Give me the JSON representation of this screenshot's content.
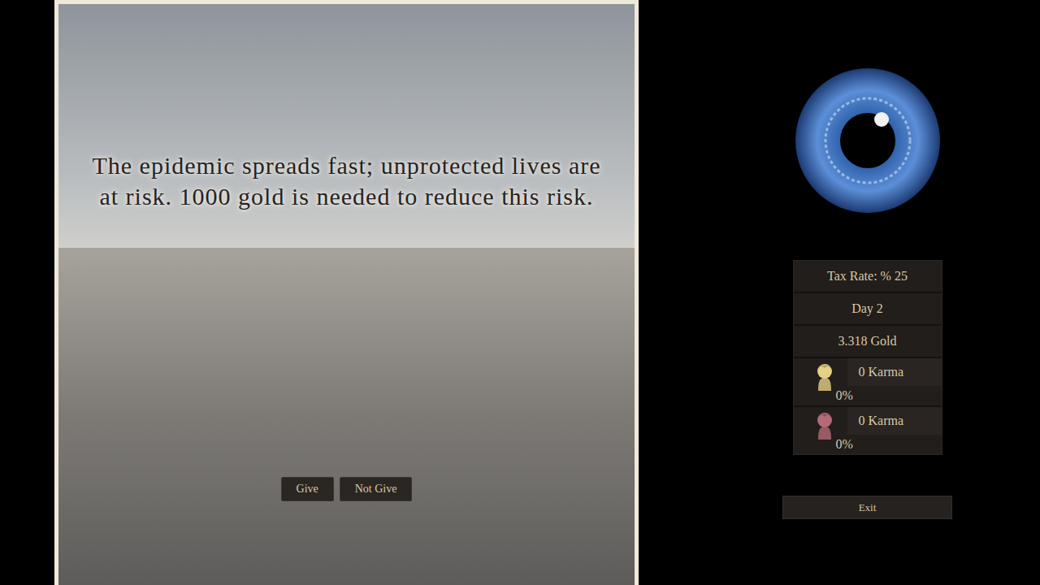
{
  "scene": {
    "caption": "The epidemic spreads fast; unprotected lives are at risk. 1000 gold is needed to reduce this risk.",
    "choices": [
      {
        "label": "Give"
      },
      {
        "label": "Not Give"
      }
    ]
  },
  "stats": {
    "tax_rate": "Tax Rate: % 25",
    "day": "Day 2",
    "gold": "3.318 Gold",
    "factions": [
      {
        "karma": "0 Karma",
        "share": "0%",
        "color": "#e6cf86"
      },
      {
        "karma": "0 Karma",
        "share": "0%",
        "color": "#b46a78"
      }
    ]
  },
  "exit": "Exit"
}
